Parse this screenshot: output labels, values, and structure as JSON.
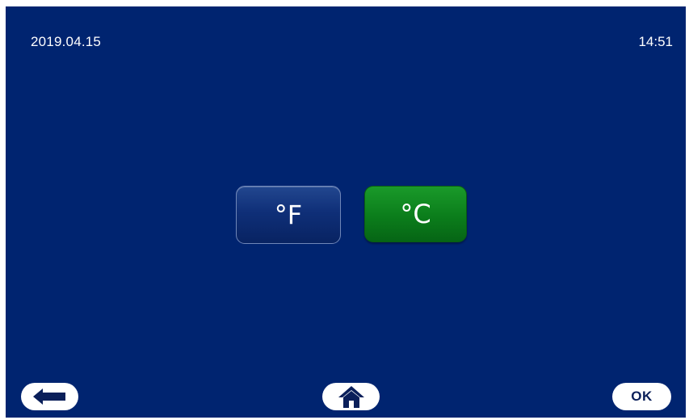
{
  "header": {
    "date": "2019.04.15",
    "time": "14:51"
  },
  "units": {
    "fahrenheit_label": "°F",
    "celsius_label": "°C",
    "selected": "°C"
  },
  "footer": {
    "back_icon": "back-arrow-icon",
    "home_icon": "home-icon",
    "ok_label": "OK"
  },
  "colors": {
    "background": "#002470",
    "selected_button": "#0b7d1b",
    "unselected_button": "#0f2f78"
  }
}
